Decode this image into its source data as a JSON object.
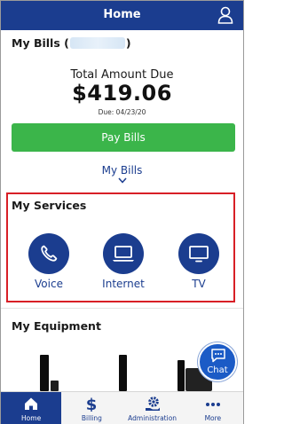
{
  "header": {
    "title": "Home",
    "user_icon": "user-icon"
  },
  "bills": {
    "heading_prefix": "My Bills (",
    "heading_suffix": ")",
    "total_label": "Total Amount Due",
    "total_amount": "$419.06",
    "due_date": "Due: 04/23/20",
    "pay_button": "Pay Bills",
    "link_label": "My Bills"
  },
  "services": {
    "title": "My Services",
    "items": [
      {
        "label": "Voice",
        "icon": "phone-icon"
      },
      {
        "label": "Internet",
        "icon": "laptop-icon"
      },
      {
        "label": "TV",
        "icon": "tv-icon"
      }
    ]
  },
  "equipment": {
    "title": "My Equipment"
  },
  "chat": {
    "label": "Chat"
  },
  "tabs": [
    {
      "label": "Home",
      "icon": "home-icon",
      "active": true
    },
    {
      "label": "Billing",
      "icon": "dollar-icon",
      "active": false
    },
    {
      "label": "Administration",
      "icon": "gear-hand-icon",
      "active": false
    },
    {
      "label": "More",
      "icon": "more-dots-icon",
      "active": false
    }
  ],
  "colors": {
    "brand_blue": "#1b3d8f",
    "pay_green": "#3bb54a",
    "highlight_red": "#d81f26",
    "chat_blue": "#1b5bc6"
  }
}
